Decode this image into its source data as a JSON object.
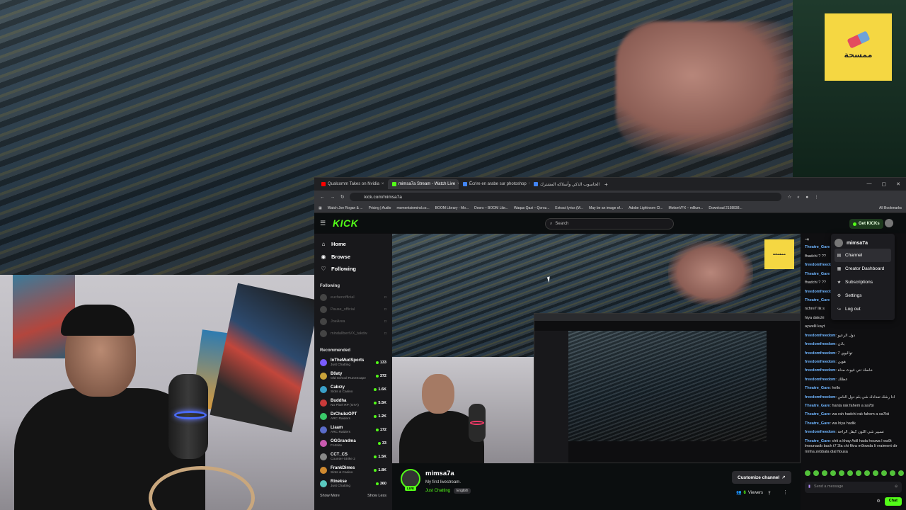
{
  "overlay": {
    "badge_text": "ممسحة"
  },
  "browser": {
    "tabs": [
      {
        "label": "Qualcomm Takes on Nvidia",
        "color": "#ff0000",
        "active": false
      },
      {
        "label": "mimsa7a Stream - Watch Live",
        "color": "#53fc18",
        "active": true
      },
      {
        "label": "Écrire en arabe sur photoshop",
        "color": "#4285f4",
        "active": false
      },
      {
        "label": "الحاسوب الذكي وأسلاكه المشترك",
        "color": "#4285f4",
        "active": false
      }
    ],
    "new_tab": "+",
    "url": "kick.com/mimsa7a",
    "bookmarks": [
      "Watch Joe Rogan & ...",
      "Pricing | Audio",
      "momentsinmind.co...",
      "BOOM Library - Mo...",
      "Doors – BOOM Libr...",
      "Waqas Qazi – Qoroz...",
      "Extract lyrics (M...",
      "May be an image of...",
      "Adobe Lightroom Cl...",
      "MotionVFX – mBum...",
      "Download 2158838...",
      "All Bookmarks"
    ]
  },
  "kick": {
    "logo": "KICK",
    "search_placeholder": "Search",
    "get_kicks": "Get KICKs",
    "nav": [
      {
        "label": "Home",
        "icon": "⌂"
      },
      {
        "label": "Browse",
        "icon": "◉"
      },
      {
        "label": "Following",
        "icon": "♡"
      }
    ],
    "following_title": "Following",
    "following": [
      {
        "name": "euchenofficial"
      },
      {
        "name": "Pause_official"
      },
      {
        "name": "JoeArea"
      },
      {
        "name": "mindallbertVX_takdw"
      }
    ],
    "recommended_title": "Recommended",
    "recommended": [
      {
        "name": "InTheMudSports",
        "category": "Just Chatting",
        "viewers": "133",
        "color": "#7a5cff"
      },
      {
        "name": "B0aty",
        "category": "Old School RuneScape",
        "viewers": "372",
        "color": "#c9a23a"
      },
      {
        "name": "Cabrzy",
        "category": "Slots & Casino",
        "viewers": "1.6K",
        "color": "#3aa0c9"
      },
      {
        "name": "Buddha",
        "category": "No Pixel RP (GTA)",
        "viewers": "5.5K",
        "color": "#c93a3a"
      },
      {
        "name": "DrChubzOPT",
        "category": "ARC Raiders",
        "viewers": "1.2K",
        "color": "#3ac96a"
      },
      {
        "name": "Liaam",
        "category": "ARC Raiders",
        "viewers": "172",
        "color": "#5a6cc9"
      },
      {
        "name": "OGGrandma",
        "category": "Fortnite",
        "viewers": "33",
        "color": "#c95ab0"
      },
      {
        "name": "CCT_CS",
        "category": "Counter-Strike 2",
        "viewers": "1.5K",
        "color": "#888888"
      },
      {
        "name": "FrankDimes",
        "category": "Slots & Casino",
        "viewers": "1.8K",
        "color": "#d08a30"
      },
      {
        "name": "Rinekse",
        "category": "Just Chatting",
        "viewers": "360",
        "color": "#5ac9c0"
      }
    ],
    "show_more": "Show More",
    "show_less": "Show Less"
  },
  "channel": {
    "name": "mimsa7a",
    "live_label": "LIVE",
    "title": "My first livestream.",
    "category": "Just Chatting",
    "language": "English",
    "customize_label": "Customize channel",
    "viewers": "6",
    "viewers_label": "Viewers"
  },
  "dropdown": {
    "username": "mimsa7a",
    "items": [
      {
        "label": "Channel",
        "icon": "▤",
        "selected": true
      },
      {
        "label": "Creator Dashboard",
        "icon": "▦",
        "selected": false
      },
      {
        "label": "Subscriptions",
        "icon": "★",
        "selected": false
      },
      {
        "label": "Settings",
        "icon": "⚙",
        "selected": false
      },
      {
        "label": "Log out",
        "icon": "↪",
        "selected": false
      }
    ]
  },
  "chat": {
    "lines": [
      {
        "user": "Theatre_Gare",
        "text": ""
      },
      {
        "user": "",
        "text": "fhadchi ? ??"
      },
      {
        "user": "freedomfreedom",
        "text": ""
      },
      {
        "user": "Theatre_Gare",
        "text": ""
      },
      {
        "user": "",
        "text": "fhadchi ? ??"
      },
      {
        "user": "freedomfreedom",
        "text": ""
      },
      {
        "user": "Theatre_Gare",
        "text": ""
      },
      {
        "user": "",
        "text": "nchre7 lik s"
      },
      {
        "user": "",
        "text": "hiya dakchi"
      },
      {
        "user": "",
        "text": "aywelli kayt"
      },
      {
        "user": "freedomfreedom",
        "text": "دول الرعيو"
      },
      {
        "user": "freedomfreedom",
        "text": "باذن"
      },
      {
        "user": "freedomfreedom",
        "text": "7 تواليوي"
      },
      {
        "user": "freedomfreedom",
        "text": "هوين"
      },
      {
        "user": "freedomfreedom",
        "text": "خاصك تني غيوث مداة"
      },
      {
        "user": "freedomfreedom",
        "text": "عظلك"
      },
      {
        "user": "Theatre_Gare",
        "text": "hello"
      },
      {
        "user": "freedomfreedom",
        "text": "ادا رشك تعدادك شي بلم دول الناس"
      },
      {
        "user": "Theatre_Gare",
        "text": "hanta rak fahem a sa7bi"
      },
      {
        "user": "Theatre_Gare",
        "text": "wa rah hadchi rak fahem a sa7bii"
      },
      {
        "user": "Theatre_Gare",
        "text": "wa hiya hadik"
      },
      {
        "user": "freedomfreedom",
        "text": "تسيير شي اللون كيقل الراحة"
      },
      {
        "user": "Theatre_Gare",
        "text": "chti a khay Adil hada houwa l wa9t lmounasib bach t7 3la chi fikra m9owda li vraiment dir mnha zebbala dial flousa"
      }
    ],
    "input_placeholder": "Send a message",
    "send_label": "Chat"
  }
}
